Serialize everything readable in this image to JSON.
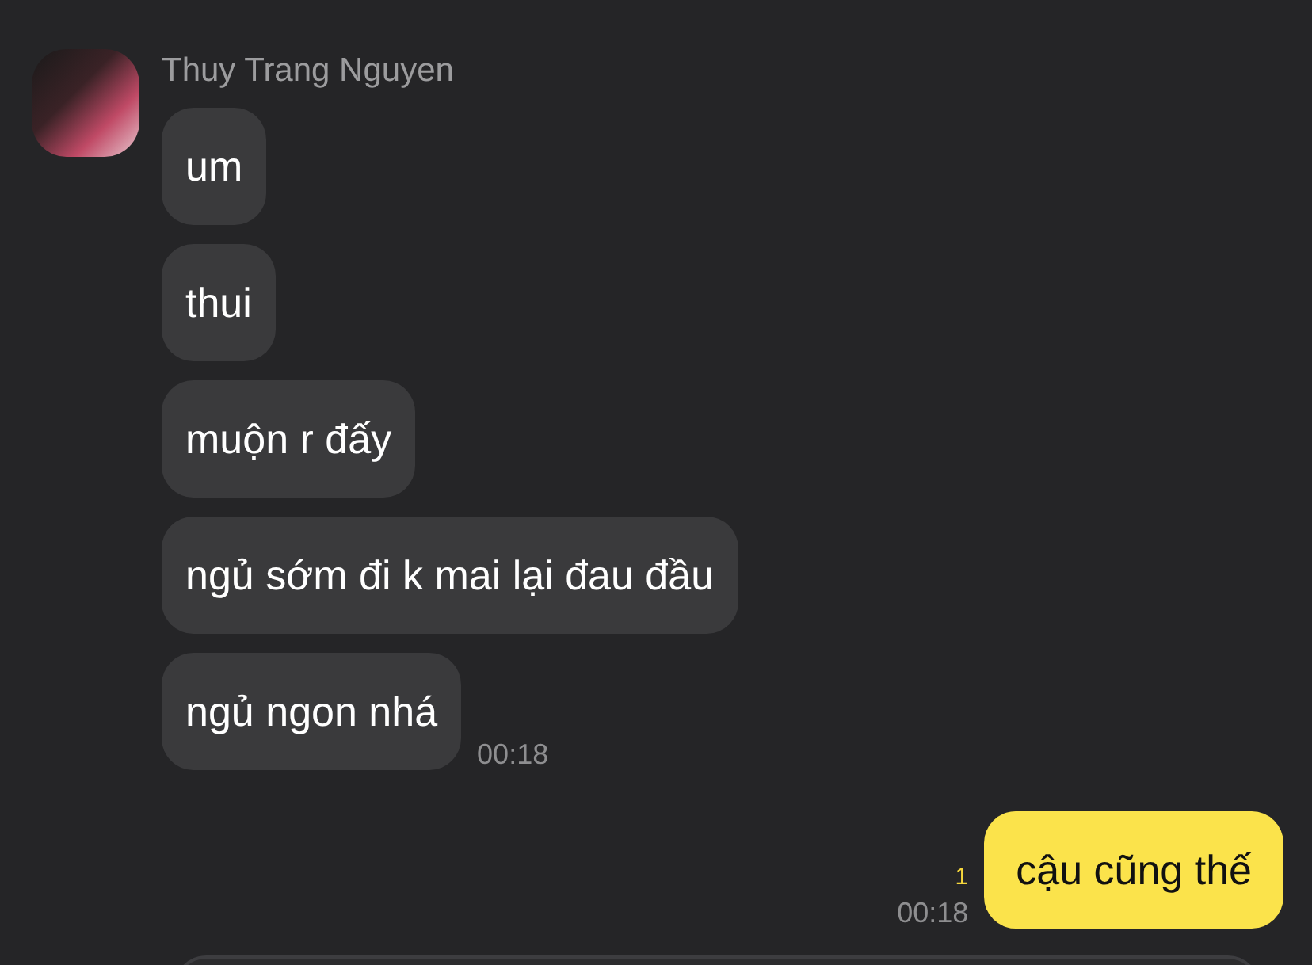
{
  "contact": {
    "name": "Thuy Trang Nguyen"
  },
  "incoming": [
    {
      "text": "um"
    },
    {
      "text": "thui"
    },
    {
      "text": "muộn r đấy"
    },
    {
      "text": "ngủ sớm đi k mai lại đau đầu"
    },
    {
      "text": "ngủ ngon nhá",
      "time": "00:18"
    }
  ],
  "outgoing": [
    {
      "text": "cậu cũng thế",
      "unread": "1",
      "time": "00:18"
    }
  ]
}
